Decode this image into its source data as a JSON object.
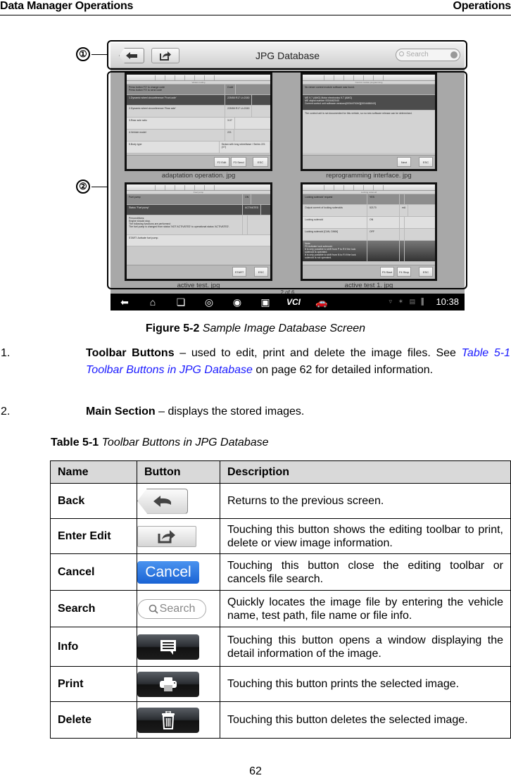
{
  "header": {
    "left": "Data Manager Operations",
    "right": "Operations"
  },
  "figure": {
    "callouts": [
      "①",
      "②"
    ],
    "app": {
      "title": "JPG Database",
      "search_placeholder": "Search",
      "page_indicator": "2 of 6",
      "clock": "10:38",
      "nav_icons": [
        "back-icon",
        "home-icon",
        "recent-apps-icon",
        "browser-icon",
        "camera-icon",
        "display-icon",
        "vci-icon",
        "car-icon"
      ],
      "nav_vci_label": "VCI"
    },
    "thumbnails": [
      {
        "caption": "adaptation operation. jpg",
        "subtitle": "Variant coding",
        "rows": [
          [
            "Press button 'F2' to change code\nPress button 'F3' to send code",
            "Code"
          ],
          [
            "1.Dynamic wheel circumference 'Front axle'",
            "225/55 R17 U=2150"
          ],
          [
            "2.Dynamic wheel circumference 'Rear axle'",
            "225/55 R17 U=2150"
          ],
          [
            "3.Rear axle ratio",
            "3.07"
          ],
          [
            "4.Vehicle model",
            "221"
          ],
          [
            "5.Body type",
            "Sedan with long wheelbase / Series 221 (V7)"
          ]
        ],
        "buttons": [
          "F2 Edit",
          "F3 Send",
          "ESC"
        ]
      },
      {
        "caption": "reprogramming interface. jpg",
        "subtitle": "Control module programming",
        "rows": [
          [
            "No newer control module software was found."
          ],
          [
            "ME 9.7 (AMG) Motor electronics 9.7 (AMG)\nME object number 0034462040\nCurrent control unit software versions[0034475240][0034486043]"
          ],
          [
            "The control unit is not documented for this vehicle, so no new software release can be determined."
          ]
        ],
        "buttons": [
          "Next",
          "ESC"
        ]
      },
      {
        "caption": "active test. jpg",
        "subtitle": "Fuel pump",
        "rows": [
          [
            "Fuel pump",
            "ON"
          ],
          [
            "Status 'Fuel pump'",
            "ACTIVATED"
          ],
          [
            "Preconditions:\nEngine should stop.\nThe following functions are performed:\nThe fuel pump is changed from status 'NOT ACTIVATED' to operational status 'ACTIVATED'.",
            ""
          ],
          [
            "START: Activate fuel pump.",
            ""
          ]
        ],
        "buttons": [
          "START",
          "ESC"
        ]
      },
      {
        "caption": "active test 1. jpg",
        "subtitle": "Locking solenoid",
        "rows": [
          [
            "Locking solenoid' request",
            "YES",
            ""
          ],
          [
            "Output current of locking solenoids",
            "52170",
            "mA"
          ],
          [
            "Locking solenoid",
            "ON",
            ""
          ],
          [
            "Locking solenoid [CAN, DWM]",
            "OFF",
            ""
          ],
          [
            "Note:\nF5 Activate lock solenoid.\nIt is only possible to shift from P to R if the lock solenoid is operated.\nIt is only possible to shift from N to R if the lock solenoid is not operated.",
            "",
            ""
          ]
        ],
        "buttons": [
          "F5 Start",
          "F4 Stop",
          "ESC"
        ]
      }
    ],
    "caption_label": "Figure 5-2",
    "caption_text": "Sample Image Database Screen"
  },
  "list": [
    {
      "num": "1.",
      "bold": "Toolbar Buttons",
      "text_before": " – used to edit, print and delete the image files. See ",
      "link": "Table 5-1 Toolbar Buttons in JPG Database",
      "text_after": " on page 62 for detailed information."
    },
    {
      "num": "2.",
      "bold": "Main Section",
      "text": " – displays the stored images."
    }
  ],
  "table": {
    "title_label": "Table 5-1",
    "title_text": "Toolbar Buttons in JPG Database",
    "headers": [
      "Name",
      "Button",
      "Description"
    ],
    "rows": [
      {
        "name": "Back",
        "icon": "back-arrow-icon",
        "description": "Returns to the previous screen."
      },
      {
        "name": "Enter Edit",
        "icon": "edit-share-icon",
        "description": "Touching this button shows the editing toolbar to print, delete or view image information."
      },
      {
        "name": "Cancel",
        "icon": "cancel-button",
        "button_text": "Cancel",
        "description": "Touching this button close the editing toolbar or cancels file search."
      },
      {
        "name": "Search",
        "icon": "search-field",
        "button_text": "Search",
        "description": "Quickly locates the image file by entering the vehicle name, test path, file name or file info."
      },
      {
        "name": "Info",
        "icon": "info-message-icon",
        "description": "Touching this button opens a window displaying the detail information of the image."
      },
      {
        "name": "Print",
        "icon": "printer-icon",
        "description": "Touching this button prints the selected image."
      },
      {
        "name": "Delete",
        "icon": "trash-icon",
        "description": "Touching this button deletes the selected image."
      }
    ]
  },
  "page_number": "62",
  "colors": {
    "link": "#1a1aff",
    "cancel_blue": "#2a72e0",
    "table_header": "#d9d9d9"
  }
}
